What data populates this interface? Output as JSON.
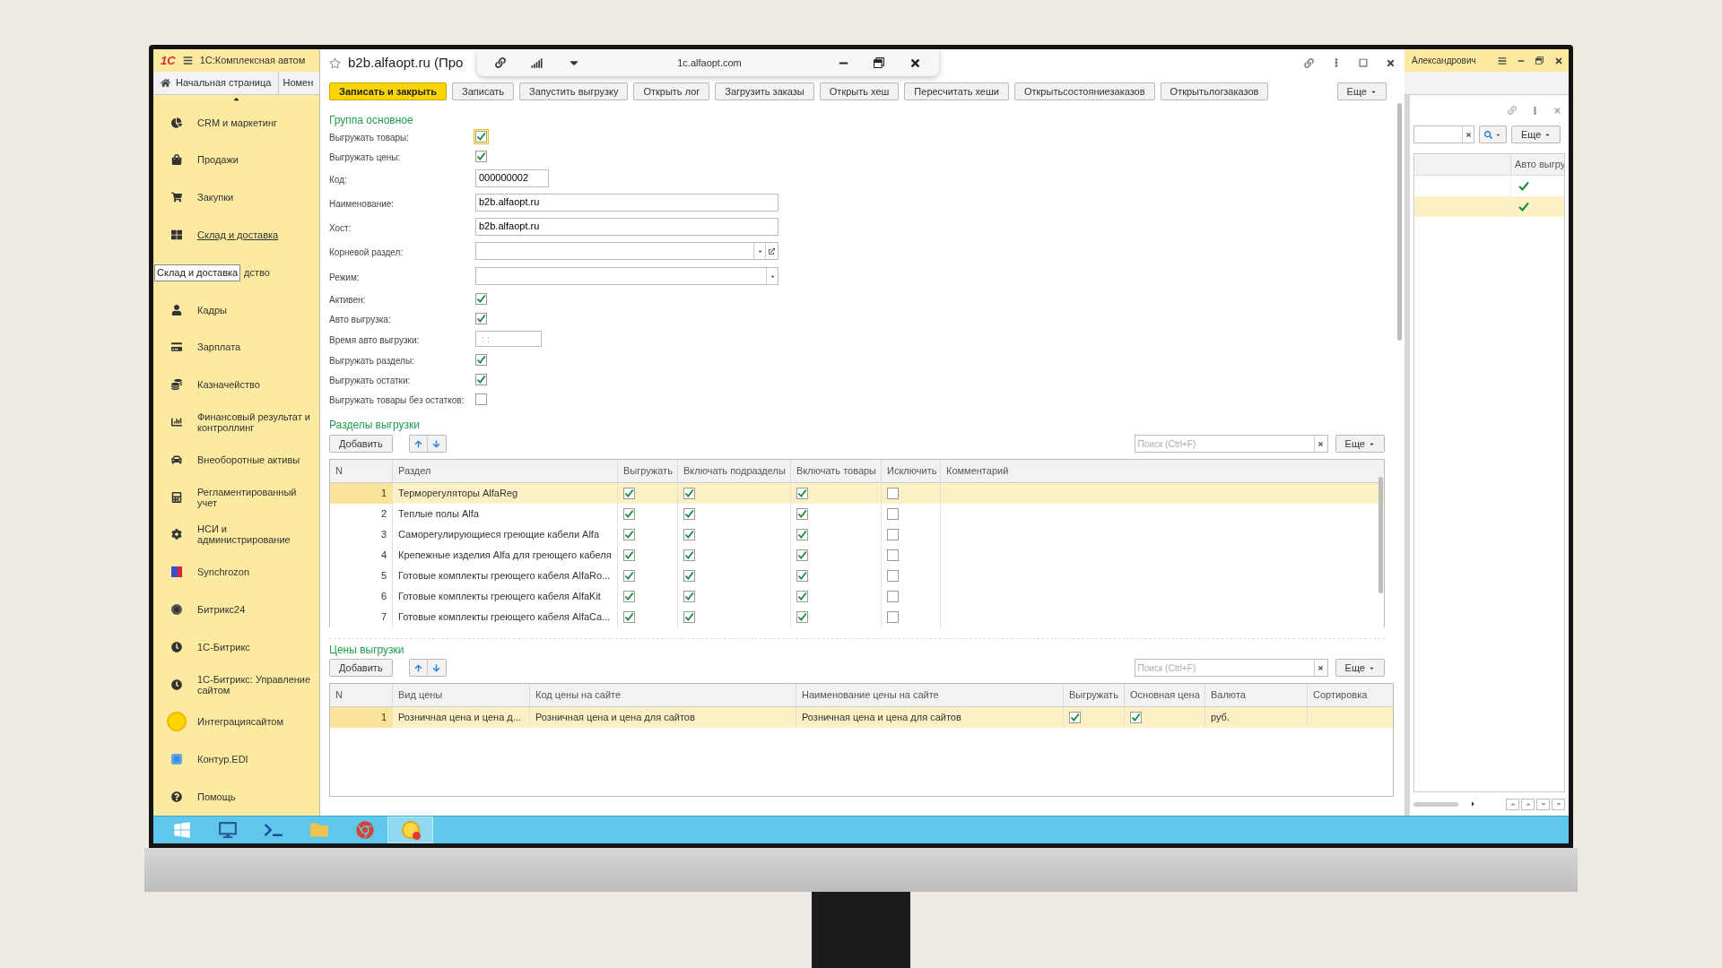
{
  "sidebar": {
    "logo": "1С",
    "app_title": "1С:Комплексная автом",
    "home_tab": "Начальная страница",
    "tab_2": "Номен",
    "tooltip": "Склад и доставка",
    "items": [
      {
        "label": "CRM и маркетинг",
        "kind": "pie",
        "hovered": false
      },
      {
        "label": "Продажи",
        "kind": "bag",
        "hovered": false
      },
      {
        "label": "Закупки",
        "kind": "cart",
        "hovered": false
      },
      {
        "label": "Склад и доставка",
        "kind": "grid",
        "hovered": true
      },
      {
        "label": "дство",
        "kind": "covered",
        "hovered": false
      },
      {
        "label": "Кадры",
        "kind": "person",
        "hovered": false
      },
      {
        "label": "Зарплата",
        "kind": "card",
        "hovered": false
      },
      {
        "label": "Казначейство",
        "kind": "coins",
        "hovered": false
      },
      {
        "label": "Финансовый результат и контроллинг",
        "kind": "chart",
        "hovered": false
      },
      {
        "label": "Внеоборотные активы",
        "kind": "car",
        "hovered": false
      },
      {
        "label": "Регламентированный учет",
        "kind": "calc",
        "hovered": false
      },
      {
        "label": "НСИ и администрирование",
        "kind": "gear",
        "hovered": false
      },
      {
        "label": "Synchrozon",
        "kind": "square",
        "hovered": false
      },
      {
        "label": "Битрикс24",
        "kind": "disc",
        "hovered": false
      },
      {
        "label": "1С-Битрикс",
        "kind": "clock",
        "hovered": false
      },
      {
        "label": "1С-Битрикс: Управление сайтом",
        "kind": "clock",
        "hovered": false
      },
      {
        "label": "Интеграциясайтом",
        "kind": "sun",
        "hovered": false
      },
      {
        "label": "Контур.EDI",
        "kind": "edi",
        "hovered": false
      },
      {
        "label": "Помощь",
        "kind": "help",
        "hovered": false
      }
    ]
  },
  "form": {
    "title": "b2b.alfaopt.ru (Про",
    "browser_bar": {
      "url": "1c.alfaopt.com"
    },
    "toolbar": [
      {
        "label": "Записать и закрыть",
        "kind": "primary"
      },
      {
        "label": "Записать",
        "kind": "normal"
      },
      {
        "label": "Запустить выгрузку",
        "kind": "normal"
      },
      {
        "label": "Открыть лог",
        "kind": "normal"
      },
      {
        "label": "Загрузить заказы",
        "kind": "normal"
      },
      {
        "label": "Открыть хеш",
        "kind": "normal"
      },
      {
        "label": "Пересчитать хеши",
        "kind": "normal"
      },
      {
        "label": "Открытьсостояниезаказов",
        "kind": "normal"
      },
      {
        "label": "Открытьлогзаказов",
        "kind": "normal"
      }
    ],
    "more": "Еще",
    "group_title": "Группа основное",
    "fields": [
      {
        "label": "Выгружать товары:",
        "kind": "checkbox",
        "checked": true,
        "focused": true
      },
      {
        "label": "Выгружать цены:",
        "kind": "checkbox",
        "checked": true,
        "focused": false
      },
      {
        "label": "Код:",
        "kind": "code",
        "value": "000000002"
      },
      {
        "label": "Наименование:",
        "kind": "text",
        "value": "b2b.alfaopt.ru"
      },
      {
        "label": "Хост:",
        "kind": "text",
        "value": "b2b.alfaopt.ru"
      },
      {
        "label": "Корневой раздел:",
        "kind": "select_link"
      },
      {
        "label": "Режим:",
        "kind": "select"
      },
      {
        "label": "Активен:",
        "kind": "checkbox",
        "checked": true,
        "focused": false
      },
      {
        "label": "Авто выгрузка:",
        "kind": "checkbox",
        "checked": true,
        "focused": false
      },
      {
        "label": "Время авто выгрузки:",
        "kind": "time",
        "placeholder": ": :"
      },
      {
        "label": "Выгружать разделы:",
        "kind": "checkbox",
        "checked": true,
        "focused": false
      },
      {
        "label": "Выгружать остатки:",
        "kind": "checkbox",
        "checked": true,
        "focused": false
      },
      {
        "label": "Выгружать товары без остатков:",
        "kind": "checkbox",
        "checked": false,
        "focused": false
      }
    ],
    "sections": {
      "title": "Разделы выгрузки",
      "add": "Добавить",
      "search_placeholder": "Поиск (Ctrl+F)",
      "more": "Еще",
      "columns": [
        "N",
        "Раздел",
        "Выгружать",
        "Включать подразделы",
        "Включать товары",
        "Исключить",
        "Комментарий"
      ],
      "rows": [
        {
          "n": "1",
          "name": "Терморегуляторы AlfaReg",
          "export": true,
          "subsections": true,
          "goods": true,
          "exclude": false,
          "selected": true
        },
        {
          "n": "2",
          "name": "Теплые полы Alfa",
          "export": true,
          "subsections": true,
          "goods": true,
          "exclude": false,
          "selected": false
        },
        {
          "n": "3",
          "name": "Саморегулирующиеся греющие кабели Alfa",
          "export": true,
          "subsections": true,
          "goods": true,
          "exclude": false,
          "selected": false
        },
        {
          "n": "4",
          "name": "Крепежные изделия Alfa для греющего кабеля",
          "export": true,
          "subsections": true,
          "goods": true,
          "exclude": false,
          "selected": false
        },
        {
          "n": "5",
          "name": "Готовые комплекты греющего кабеля AlfaRo...",
          "export": true,
          "subsections": true,
          "goods": true,
          "exclude": false,
          "selected": false
        },
        {
          "n": "6",
          "name": "Готовые комплекты греющего кабеля AlfaKit",
          "export": true,
          "subsections": true,
          "goods": true,
          "exclude": false,
          "selected": false
        },
        {
          "n": "7",
          "name": "Готовые комплекты греющего кабеля AlfaCa...",
          "export": true,
          "subsections": true,
          "goods": true,
          "exclude": false,
          "selected": false
        }
      ]
    },
    "prices": {
      "title": "Цены выгрузки",
      "add": "Добавить",
      "search_placeholder": "Поиск (Ctrl+F)",
      "more": "Еще",
      "columns": [
        "N",
        "Вид цены",
        "Код цены на сайте",
        "Наименование цены на сайте",
        "Выгружать",
        "Основная цена",
        "Валюта",
        "Сортировка"
      ],
      "rows": [
        {
          "n": "1",
          "price_type": "Розничная цена и цена д...",
          "code": "Розничная цена и цена для сайтов",
          "name": "Розничная цена и цена для сайтов",
          "export": true,
          "main": true,
          "currency": "руб.",
          "selected": true
        }
      ]
    }
  },
  "right_panel": {
    "user": "Александрович",
    "more": "Еще",
    "column": "Авто выгру",
    "rows": [
      {
        "checked": true,
        "selected": false
      },
      {
        "checked": true,
        "selected": true
      }
    ]
  }
}
